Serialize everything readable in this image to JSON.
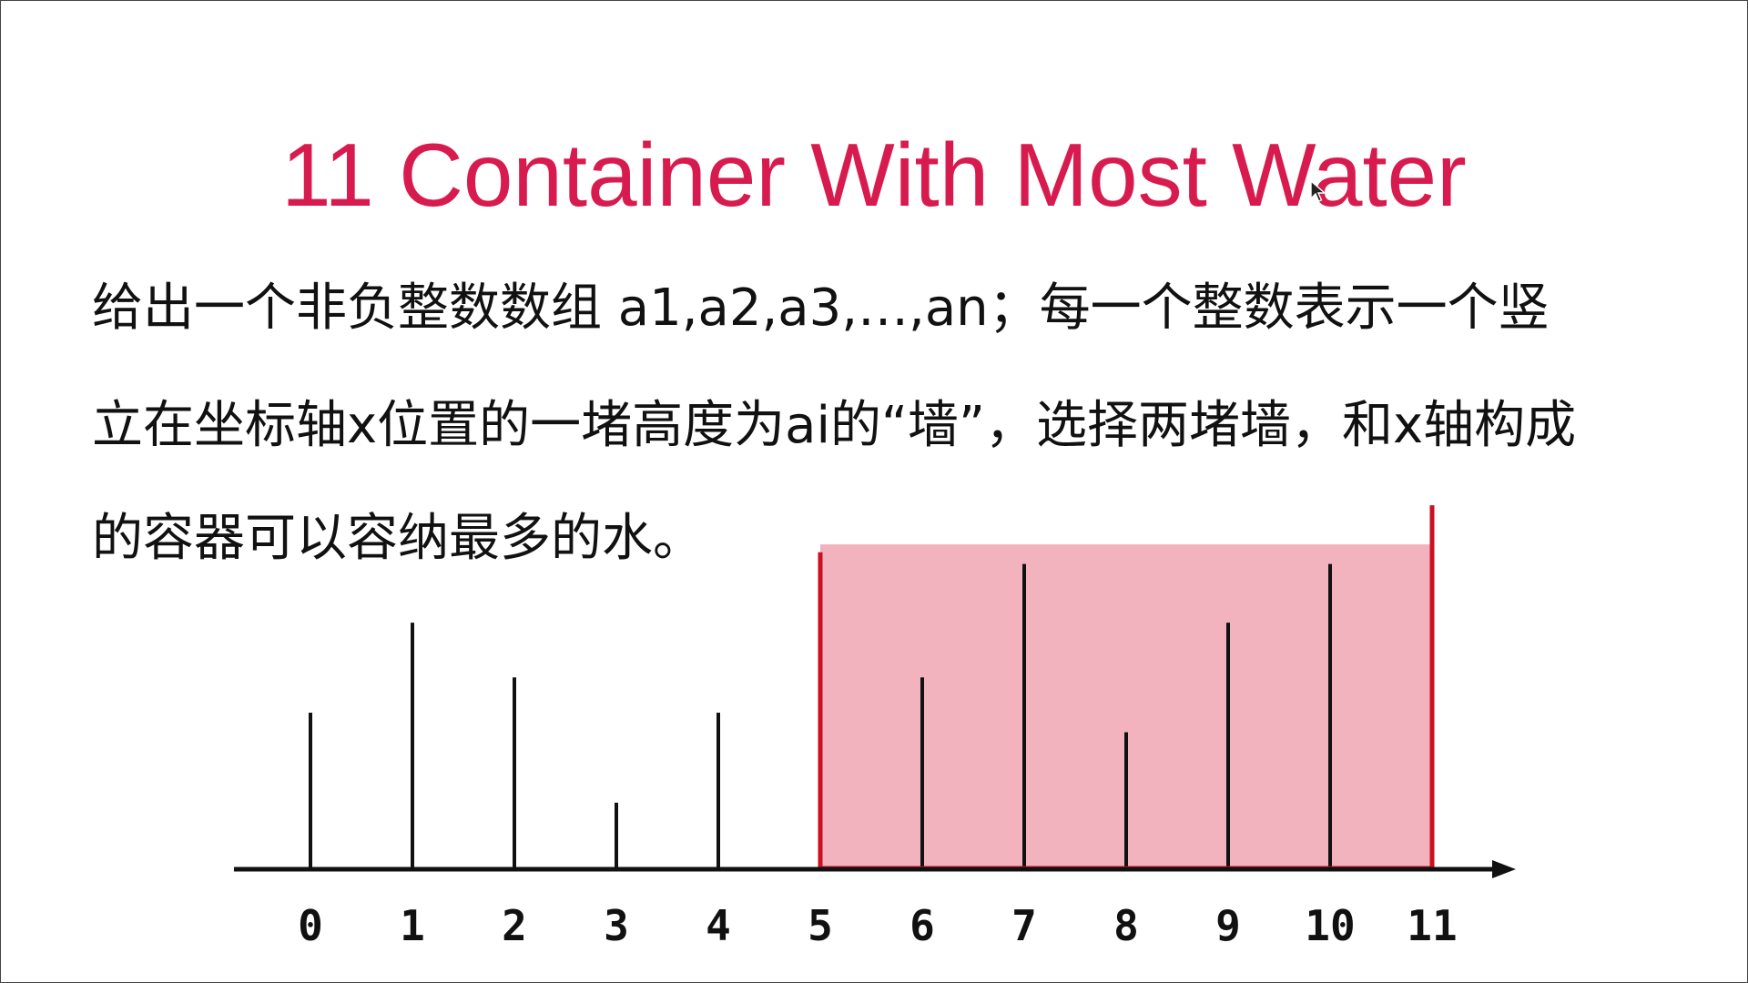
{
  "slide": {
    "title": "11 Container With Most Water",
    "description_lines": [
      "给出一个非负整数数组 a1,a2,a3,…,an；每一个整数表示一个竖",
      "立在坐标轴x位置的一堵高度为ai的“墙”，选择两堵墙，和x轴构成",
      "的容器可以容纳最多的水。"
    ]
  },
  "colors": {
    "title": "#d81b4e",
    "wall": "#111111",
    "container_edge": "#cc1020",
    "water_fill": "#f2b3bf",
    "axis": "#111111"
  },
  "chart_data": {
    "type": "bar",
    "categories": [
      "0",
      "1",
      "2",
      "3",
      "4",
      "5",
      "6",
      "7",
      "8",
      "9",
      "10",
      "11"
    ],
    "values": [
      4.0,
      6.3,
      4.9,
      1.7,
      4.0,
      8.1,
      4.9,
      7.8,
      3.5,
      6.3,
      7.8,
      9.3
    ],
    "highlight": {
      "left_index": 5,
      "right_index": 11,
      "water_level": 8.3
    },
    "xlabel": "",
    "ylabel": "",
    "ylim": [
      0,
      9.5
    ],
    "axis_arrow": true,
    "grid": false
  },
  "icons": {
    "cursor": "mouse-pointer-icon"
  }
}
